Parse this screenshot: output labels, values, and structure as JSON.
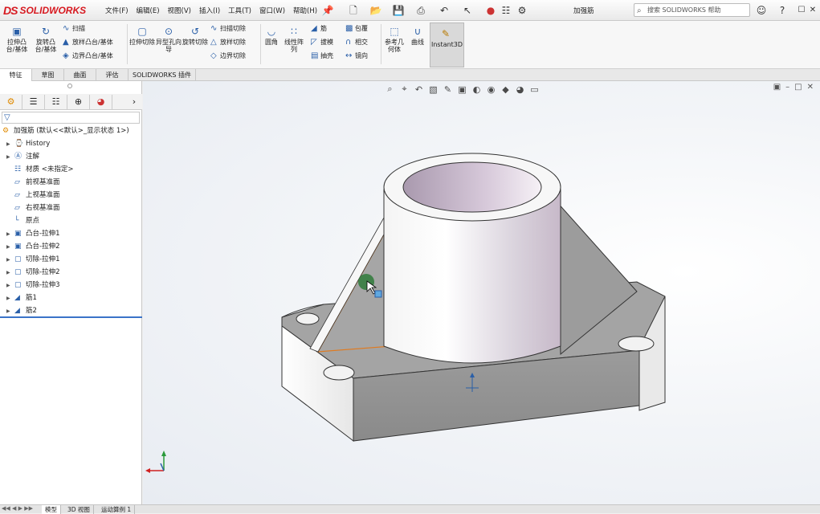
{
  "app": {
    "brand": "SOLIDWORKS",
    "doc_title": "加强筋"
  },
  "menu": [
    "文件(F)",
    "编辑(E)",
    "视图(V)",
    "插入(I)",
    "工具(T)",
    "窗口(W)",
    "帮助(H)"
  ],
  "search": {
    "placeholder": "搜索 SOLIDWORKS 帮助"
  },
  "commands": {
    "extrude_boss": "拉伸凸台/基体",
    "revolve_boss": "旋转凸台/基体",
    "sweep": "扫描",
    "loft": "放样凸台/基体",
    "boundary": "边界凸台/基体",
    "extrude_cut": "拉伸切除",
    "hole_wizard": "异型孔向导",
    "revolve_cut": "旋转切除",
    "sweep_cut": "扫描切除",
    "loft_cut": "放样切除",
    "boundary_cut": "边界切除",
    "fillet": "圆角",
    "linear_pattern": "线性阵列",
    "rib": "筋",
    "draft": "拔模",
    "shell": "抽壳",
    "wrap": "包覆",
    "intersect": "相交",
    "mirror": "镜向",
    "ref_geometry": "参考几何体",
    "curves": "曲线",
    "instant3d": "Instant3D"
  },
  "tabs": [
    "特征",
    "草图",
    "曲面",
    "评估",
    "SOLIDWORKS 插件"
  ],
  "tree": {
    "root": "加强筋  (默认<<默认>_显示状态 1>)",
    "items": [
      {
        "label": "History",
        "icon": "history-icon",
        "expandable": true
      },
      {
        "label": "注解",
        "icon": "annotation-icon",
        "expandable": true
      },
      {
        "label": "材质 <未指定>",
        "icon": "material-icon",
        "expandable": false
      },
      {
        "label": "前视基准面",
        "icon": "plane-icon",
        "expandable": false
      },
      {
        "label": "上视基准面",
        "icon": "plane-icon",
        "expandable": false
      },
      {
        "label": "右视基准面",
        "icon": "plane-icon",
        "expandable": false
      },
      {
        "label": "原点",
        "icon": "origin-icon",
        "expandable": false
      },
      {
        "label": "凸台-拉伸1",
        "icon": "boss-extrude-icon",
        "expandable": true
      },
      {
        "label": "凸台-拉伸2",
        "icon": "boss-extrude-icon",
        "expandable": true
      },
      {
        "label": "切除-拉伸1",
        "icon": "cut-extrude-icon",
        "expandable": true
      },
      {
        "label": "切除-拉伸2",
        "icon": "cut-extrude-icon",
        "expandable": true
      },
      {
        "label": "切除-拉伸3",
        "icon": "cut-extrude-icon",
        "expandable": true
      },
      {
        "label": "筋1",
        "icon": "rib-icon",
        "expandable": true
      },
      {
        "label": "筋2",
        "icon": "rib-icon",
        "expandable": true
      }
    ]
  },
  "statusbar": {
    "tabs": [
      "模型",
      "3D 视图",
      "运动算例 1"
    ]
  },
  "colors": {
    "accent": "#2a5fa8",
    "brand": "#d71920",
    "selection_edge": "#e07a1f"
  }
}
